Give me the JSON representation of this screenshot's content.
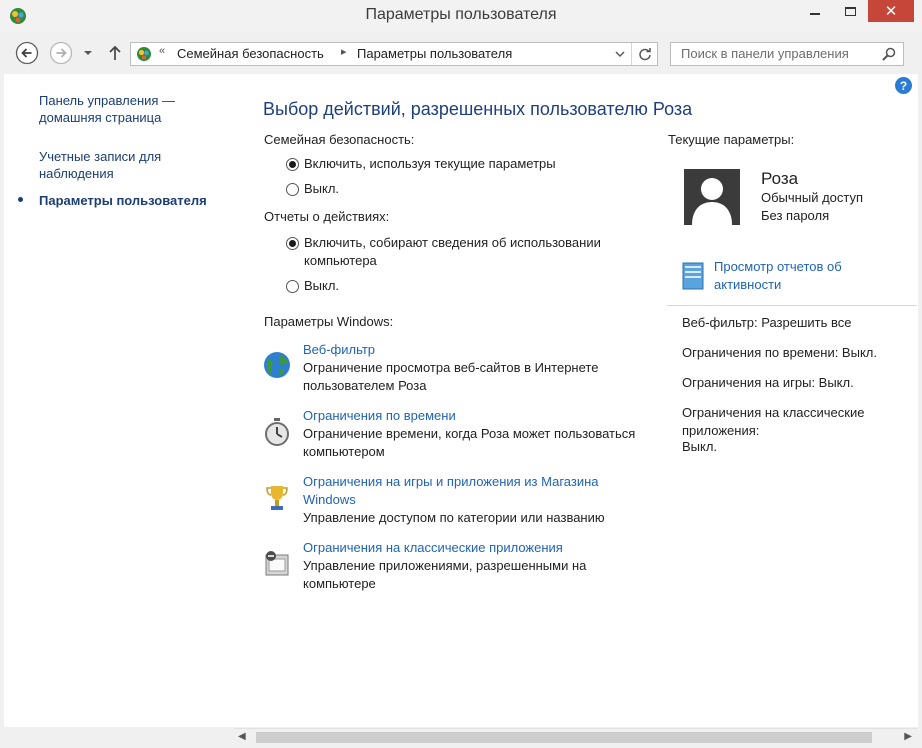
{
  "window": {
    "title": "Параметры пользователя"
  },
  "nav": {
    "breadcrumbs_prefix": "«",
    "crumb1": "Семейная безопасность",
    "crumb2": "Параметры пользователя",
    "search_placeholder": "Поиск в панели управления",
    "help": "?"
  },
  "sidebar": {
    "items": [
      {
        "label": "Панель управления — домашняя страница"
      },
      {
        "label": "Учетные записи для наблюдения"
      },
      {
        "label": "Параметры пользователя"
      }
    ]
  },
  "main": {
    "heading": "Выбор действий, разрешенных пользователю Роза",
    "family_safety_label": "Семейная безопасность:",
    "family_safety_on": "Включить, используя текущие параметры",
    "family_safety_off": "Выкл.",
    "reports_label": "Отчеты о действиях:",
    "reports_on": "Включить, собирают сведения об использовании компьютера",
    "reports_off": "Выкл.",
    "windows_settings_label": "Параметры Windows:",
    "tasks": [
      {
        "link": "Веб-фильтр",
        "desc": "Ограничение просмотра веб-сайтов в Интернете пользователем Роза"
      },
      {
        "link": "Ограничения по времени",
        "desc": "Ограничение времени, когда Роза может пользоваться компьютером"
      },
      {
        "link": "Ограничения на игры и приложения из Магазина Windows",
        "desc": "Управление доступом по категории или названию"
      },
      {
        "link": "Ограничения на классические приложения",
        "desc": "Управление приложениями, разрешенными на компьютере"
      }
    ]
  },
  "current": {
    "label": "Текущие параметры:",
    "user_name": "Роза",
    "access": "Обычный доступ",
    "password": "Без пароля",
    "report_link": "Просмотр отчетов об активности",
    "web_filter": "Веб-фильтр: Разрешить все",
    "time_limits": "Ограничения по времени: Выкл.",
    "game_limits": "Ограничения на игры: Выкл.",
    "classic_limits": "Ограничения на классические приложения:",
    "classic_value": "Выкл."
  },
  "colors": {
    "link": "#1f63b6",
    "heading": "#1e3f7f",
    "close_button": "#c7463a"
  }
}
